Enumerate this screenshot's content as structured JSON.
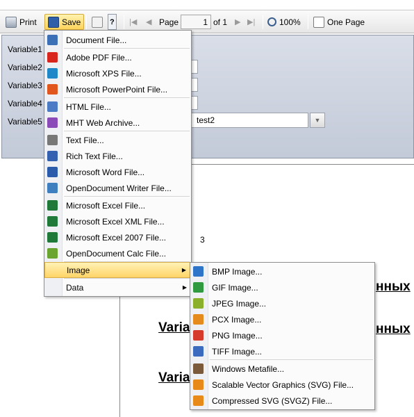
{
  "toolbar": {
    "print_label": "Print",
    "save_label": "Save",
    "page_label": "Page",
    "page_value": "1",
    "of_label": "of 1",
    "zoom_label": "100%",
    "view_label": "One Page"
  },
  "params": {
    "labels": [
      "Variable1",
      "Variable2",
      "Variable3",
      "Variable4",
      "Variable5"
    ],
    "variable5_value": "test2"
  },
  "report": {
    "number": "3",
    "heading_left": "Varia",
    "heading_right": "нных"
  },
  "save_menu": {
    "items": [
      {
        "label": "Document File...",
        "icon": "document-icon",
        "color": "#3b6fb6"
      },
      {
        "label": "Adobe PDF File...",
        "icon": "pdf-icon",
        "color": "#d8261f"
      },
      {
        "label": "Microsoft XPS File...",
        "icon": "xps-icon",
        "color": "#1e88c8"
      },
      {
        "label": "Microsoft PowerPoint File...",
        "icon": "powerpoint-icon",
        "color": "#e0561d"
      },
      {
        "label": "HTML File...",
        "icon": "html-icon",
        "color": "#4a7bc4"
      },
      {
        "label": "MHT Web Archive...",
        "icon": "mht-icon",
        "color": "#8a4bb8"
      },
      {
        "label": "Text File...",
        "icon": "text-file-icon",
        "color": "#777777"
      },
      {
        "label": "Rich Text File...",
        "icon": "rtf-icon",
        "color": "#3461b0"
      },
      {
        "label": "Microsoft Word File...",
        "icon": "word-icon",
        "color": "#2a5cab"
      },
      {
        "label": "OpenDocument Writer File...",
        "icon": "odt-icon",
        "color": "#3d7fbf"
      },
      {
        "label": "Microsoft Excel File...",
        "icon": "excel-icon",
        "color": "#1f7a3a"
      },
      {
        "label": "Microsoft Excel XML File...",
        "icon": "excel-xml-icon",
        "color": "#1f7a3a"
      },
      {
        "label": "Microsoft Excel 2007 File...",
        "icon": "excel-2007-icon",
        "color": "#1f7a3a"
      },
      {
        "label": "OpenDocument Calc File...",
        "icon": "ods-icon",
        "color": "#6aa532"
      },
      {
        "label": "Image",
        "icon": "",
        "color": ""
      },
      {
        "label": "Data",
        "icon": "",
        "color": ""
      }
    ]
  },
  "image_menu": {
    "items": [
      {
        "label": "BMP Image...",
        "icon": "bmp-icon",
        "color": "#2e74c8"
      },
      {
        "label": "GIF Image...",
        "icon": "gif-icon",
        "color": "#2f9a3f"
      },
      {
        "label": "JPEG Image...",
        "icon": "jpeg-icon",
        "color": "#8bb02c"
      },
      {
        "label": "PCX Image...",
        "icon": "pcx-icon",
        "color": "#e58a1c"
      },
      {
        "label": "PNG Image...",
        "icon": "png-icon",
        "color": "#d63a2a"
      },
      {
        "label": "TIFF Image...",
        "icon": "tiff-icon",
        "color": "#3a6bbf"
      },
      {
        "label": "Windows Metafile...",
        "icon": "wmf-icon",
        "color": "#7a5a3a"
      },
      {
        "label": "Scalable Vector Graphics (SVG) File...",
        "icon": "svg-icon",
        "color": "#e88a1a"
      },
      {
        "label": "Compressed SVG (SVGZ) File...",
        "icon": "svgz-icon",
        "color": "#e88a1a"
      }
    ]
  }
}
